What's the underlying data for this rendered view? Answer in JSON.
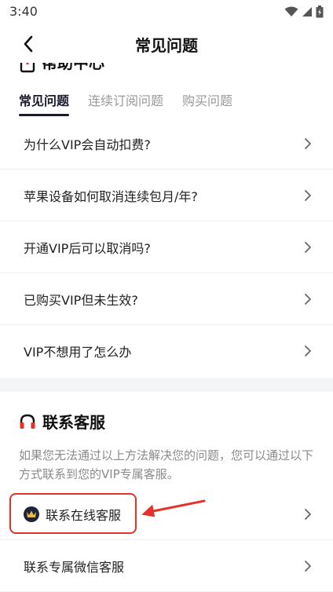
{
  "status_bar": {
    "time": "3:40"
  },
  "nav": {
    "title": "常见问题"
  },
  "help_center": {
    "title": "帮助中心"
  },
  "tabs": [
    {
      "label": "常见问题",
      "active": true
    },
    {
      "label": "连续订阅问题",
      "active": false
    },
    {
      "label": "购买问题",
      "active": false
    }
  ],
  "faq_items": [
    {
      "label": "为什么VIP会自动扣费?"
    },
    {
      "label": "苹果设备如何取消连续包月/年?"
    },
    {
      "label": "开通VIP后可以取消吗?"
    },
    {
      "label": "已购买VIP但未生效?"
    },
    {
      "label": "VIP不想用了怎么办"
    }
  ],
  "contact": {
    "title": "联系客服",
    "description": "如果您无法通过以上方法解决您的问题，您可以通过以下方式联系到您的VIP专属客服。",
    "items": [
      {
        "label": "联系在线客服"
      },
      {
        "label": "联系专属微信客服"
      }
    ]
  },
  "colors": {
    "accent": "#1a1a2e",
    "annotation": "#e4322b",
    "muted": "#8a8a8a"
  }
}
